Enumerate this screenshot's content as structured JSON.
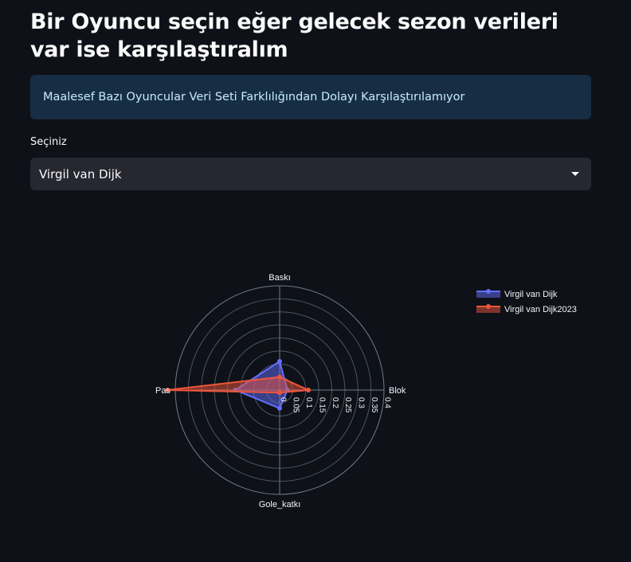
{
  "page": {
    "title": "Bir Oyuncu seçin eğer gelecek sezon verileri var ise karşılaştıralım",
    "info_message": "Maalesef Bazı Oyuncular Veri Seti Farklılığından Dolayı Karşılaştırılamıyor",
    "select_label": "Seçiniz",
    "select_value": "Virgil van Dijk"
  },
  "colors": {
    "background": "#0e1117",
    "info_bg": "#172d43",
    "info_text": "#c7ebff",
    "select_bg": "#262730",
    "series_1": "#636efa",
    "series_2": "#ef553b"
  },
  "chart_data": {
    "type": "radar",
    "categories": [
      "Baskı",
      "Blok",
      "Gole_katkı",
      "Pas"
    ],
    "radial_ticks": [
      "0",
      "0.05",
      "0.1",
      "0.15",
      "0.2",
      "0.25",
      "0.3",
      "0.35",
      "0.4"
    ],
    "r_range": [
      0,
      0.4
    ],
    "grid": true,
    "legend_position": "top-right",
    "series": [
      {
        "name": "Virgil van Dijk",
        "color": "#636efa",
        "values": [
          0.11,
          0.03,
          0.07,
          0.17
        ]
      },
      {
        "name": "Virgil van Dijk2023",
        "color": "#ef553b",
        "values": [
          0.05,
          0.11,
          0.01,
          0.43
        ]
      }
    ]
  }
}
